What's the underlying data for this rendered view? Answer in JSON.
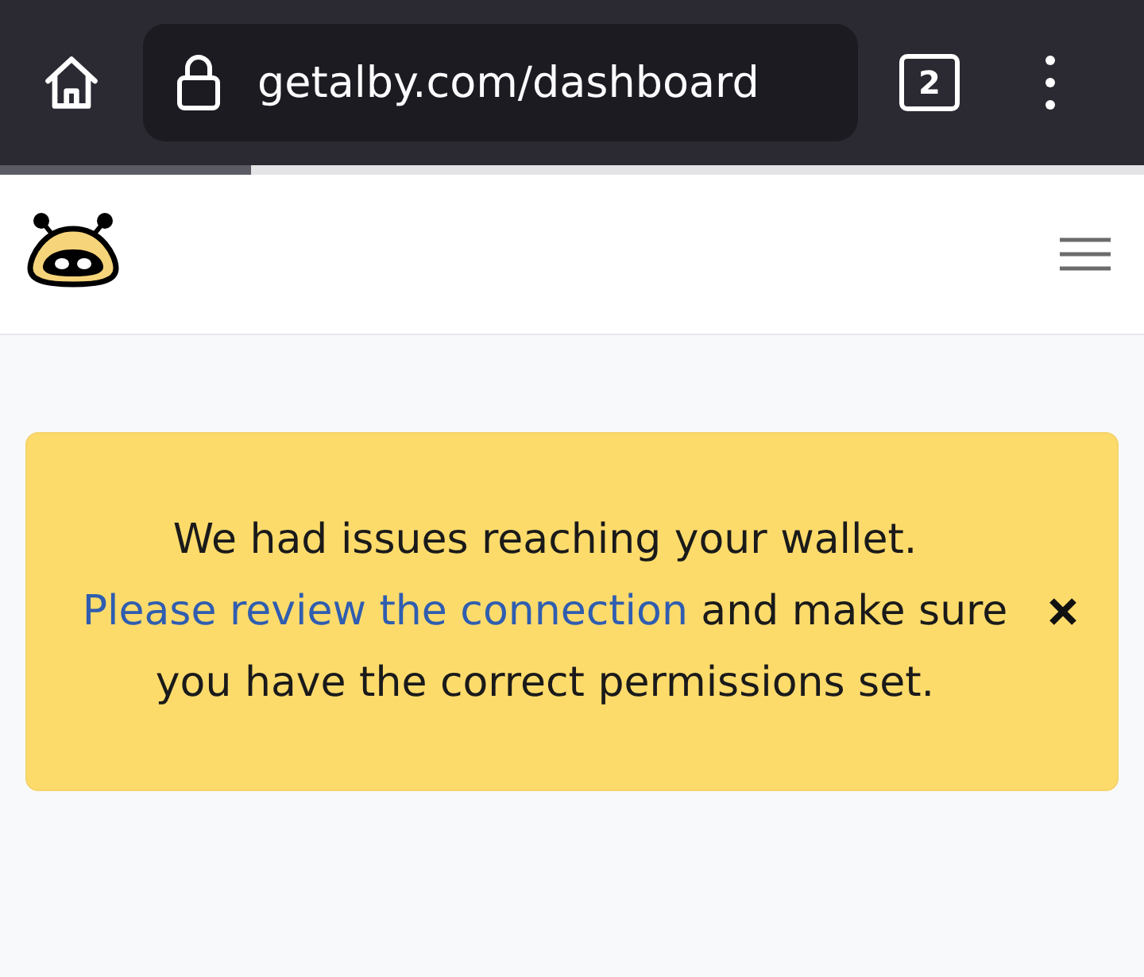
{
  "browser": {
    "url": "getalby.com/dashboard",
    "tab_count": "2",
    "load_progress": {
      "level": 0.22
    }
  },
  "alert": {
    "text_before": "We had issues reaching your wallet.",
    "link": "Please review the connection",
    "text_after": "and make sure you have the correct permissions set."
  }
}
